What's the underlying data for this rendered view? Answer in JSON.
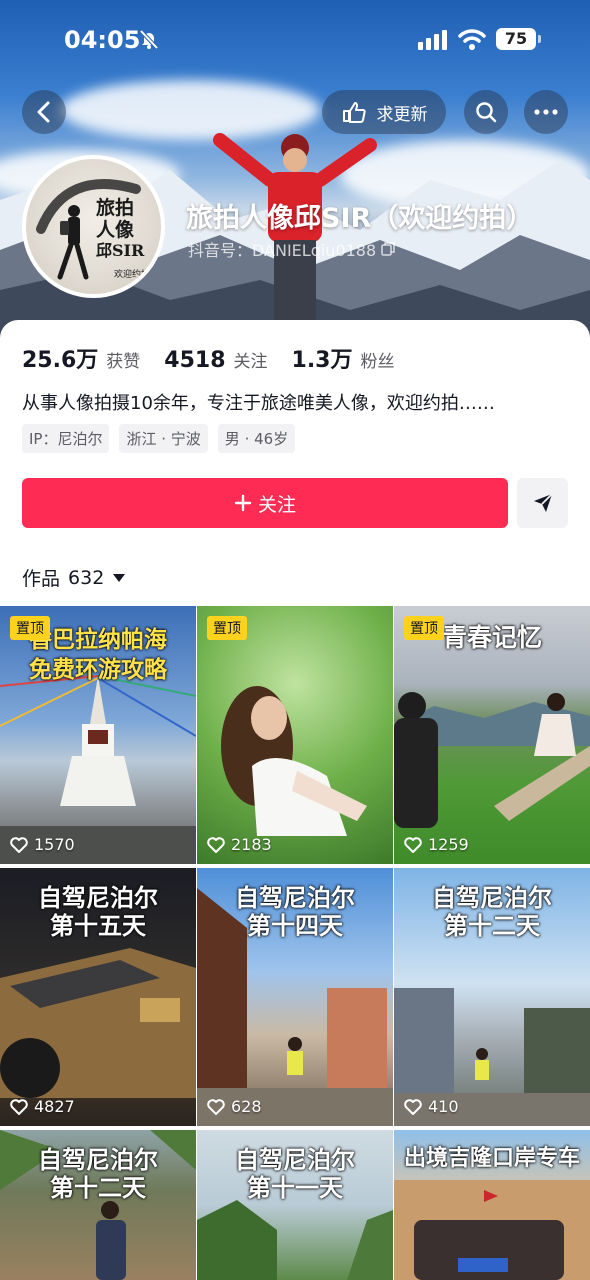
{
  "status_bar": {
    "time": "04:05",
    "battery": "75"
  },
  "header": {
    "update_label": "求更新",
    "name": "旅拍人像邱SIR（欢迎约拍）",
    "douyin_id": "抖音号：DANIELqiu0188"
  },
  "avatar_logo": {
    "line1": "旅拍",
    "line2": "人像",
    "line3": "邱SIR",
    "sub": "欢迎约拍"
  },
  "stats": [
    {
      "num": "25.6万",
      "label": "获赞"
    },
    {
      "num": "4518",
      "label": "关注"
    },
    {
      "num": "1.3万",
      "label": "粉丝"
    }
  ],
  "bio": "从事人像拍摄10余年，专注于旅途唯美人像，欢迎约拍……",
  "tags": [
    "IP：尼泊尔",
    "浙江 · 宁波",
    "男 · 46岁"
  ],
  "follow_label": "关注",
  "works": {
    "label": "作品",
    "count": "632"
  },
  "grid": [
    {
      "pin": "置顶",
      "title": "香巴拉纳帕海",
      "title2": "免费环游攻略",
      "likes": "1570"
    },
    {
      "pin": "置顶",
      "title": "",
      "title2": "",
      "likes": "2183"
    },
    {
      "pin": "置顶",
      "title": "青春记忆",
      "title2": "",
      "likes": "1259"
    },
    {
      "pin": "",
      "title": "自驾尼泊尔",
      "title2": "第十五天",
      "likes": "4827"
    },
    {
      "pin": "",
      "title": "自驾尼泊尔",
      "title2": "第十四天",
      "likes": "628"
    },
    {
      "pin": "",
      "title": "自驾尼泊尔",
      "title2": "第十二天",
      "likes": "410"
    },
    {
      "pin": "",
      "title": "自驾尼泊尔",
      "title2": "第十二天",
      "likes": ""
    },
    {
      "pin": "",
      "title": "自驾尼泊尔",
      "title2": "第十一天",
      "likes": ""
    },
    {
      "pin": "",
      "title": "出境吉隆口岸专车",
      "title2": "",
      "likes": ""
    }
  ],
  "colors": {
    "accent": "#fe2c55",
    "pin": "#fcd21c"
  }
}
